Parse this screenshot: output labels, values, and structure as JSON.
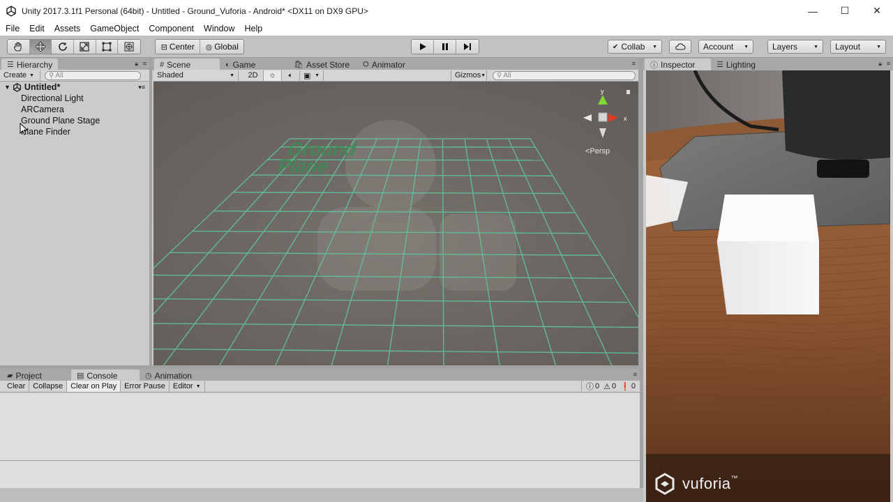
{
  "window": {
    "title": "Unity 2017.3.1f1 Personal (64bit) - Untitled - Ground_Vuforia - Android* <DX11 on DX9 GPU>",
    "minimize": "—",
    "maximize": "☐",
    "close": "✕"
  },
  "menu": [
    "File",
    "Edit",
    "Assets",
    "GameObject",
    "Component",
    "Window",
    "Help"
  ],
  "toolbar": {
    "pivot": "Center",
    "space": "Global",
    "collab": "Collab",
    "account": "Account",
    "layers": "Layers",
    "layout": "Layout"
  },
  "hierarchy": {
    "tab": "Hierarchy",
    "create": "Create",
    "search_placeholder": "All",
    "scene_name": "Untitled*",
    "items": [
      "Directional Light",
      "ARCamera",
      "Ground Plane Stage",
      "Plane Finder"
    ]
  },
  "scene_tabs": {
    "scene": "Scene",
    "game": "Game",
    "asset_store": "Asset Store",
    "animator": "Animator"
  },
  "scene_bar": {
    "shading": "Shaded",
    "mode_2d": "2D",
    "gizmos": "Gizmos",
    "search_placeholder": "All"
  },
  "scene_view": {
    "ground_label_line1": "Ground",
    "ground_label_line2": "Plane",
    "persp": "Persp",
    "axis_y": "y",
    "axis_x": "x"
  },
  "inspector": {
    "tab": "Inspector",
    "lighting_tab": "Lighting",
    "brand": "vuforia",
    "brand_tm": "™"
  },
  "console": {
    "tabs": [
      "Project",
      "Console",
      "Animation"
    ],
    "clear": "Clear",
    "collapse": "Collapse",
    "clear_on_play": "Clear on Play",
    "error_pause": "Error Pause",
    "editor": "Editor",
    "log_count": "0",
    "warning_count": "0",
    "error_count": "0"
  },
  "colors": {
    "grid": "#5fc39a",
    "axis_y": "#7fd63a",
    "axis_x": "#e23b24"
  }
}
